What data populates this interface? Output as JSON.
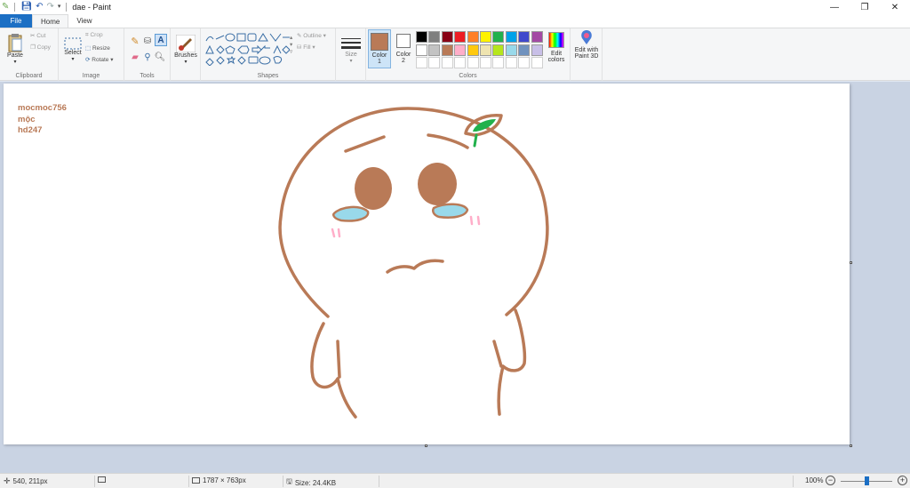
{
  "window": {
    "title": "dae - Paint",
    "controls": {
      "minimize": "—",
      "maximize": "❐",
      "close": "✕"
    }
  },
  "tabs": {
    "file": "File",
    "home": "Home",
    "view": "View"
  },
  "ribbon": {
    "clipboard": {
      "paste": "Paste",
      "cut": "Cut",
      "copy": "Copy",
      "label": "Clipboard"
    },
    "image": {
      "select": "Select",
      "crop": "Crop",
      "resize": "Resize",
      "rotate": "Rotate",
      "label": "Image"
    },
    "tools": {
      "label": "Tools"
    },
    "brushes": {
      "label": "Brushes"
    },
    "shapes": {
      "outline": "Outline",
      "fill": "Fill",
      "label": "Shapes"
    },
    "size": {
      "label": "Size"
    },
    "colors": {
      "color1_label": "Color",
      "color1_num": "1",
      "color2_label": "Color",
      "color2_num": "2",
      "edit_colors_1": "Edit",
      "edit_colors_2": "colors",
      "paint3d_1": "Edit with",
      "paint3d_2": "Paint 3D",
      "label": "Colors",
      "color1_value": "#b97a57",
      "color2_value": "#ffffff",
      "palette_row1": [
        "#000000",
        "#7f7f7f",
        "#880015",
        "#ed1c24",
        "#ff7f27",
        "#fff200",
        "#22b14c",
        "#00a2e8",
        "#3f48cc",
        "#a349a4"
      ],
      "palette_row2": [
        "#ffffff",
        "#c3c3c3",
        "#b97a57",
        "#ffaec9",
        "#ffc90e",
        "#efe4b0",
        "#b5e61d",
        "#99d9ea",
        "#7092be",
        "#c8bfe7"
      ]
    }
  },
  "canvas": {
    "names": [
      "mocmoc756",
      "mộc",
      "hd247"
    ],
    "stroke_color": "#b97a57",
    "tear_color": "#99d9ea",
    "leaf_color": "#22b14c",
    "blush_color": "#ffaec9"
  },
  "status": {
    "cursor": "540, 211px",
    "selection": "",
    "dimensions": "1787 × 763px",
    "size": "Size: 24.4KB",
    "zoom": "100%",
    "zoom_value": 1.0
  }
}
